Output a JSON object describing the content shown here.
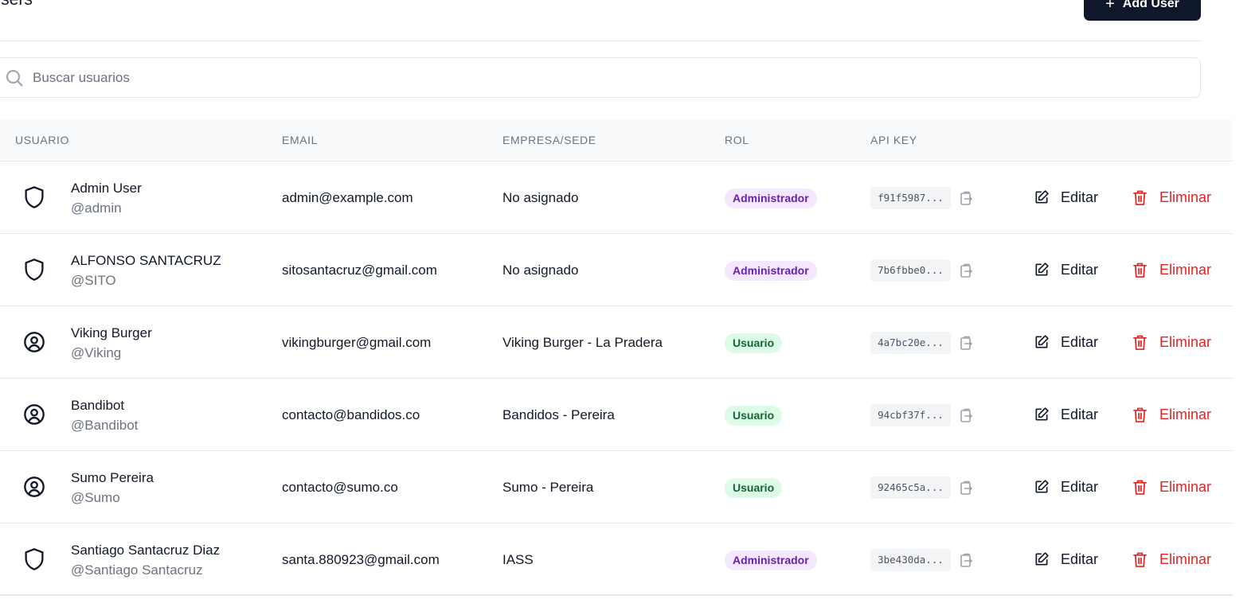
{
  "header": {
    "title": "Users",
    "add_user_label": "Add User"
  },
  "search": {
    "placeholder": "Buscar usuarios"
  },
  "table": {
    "columns": [
      "USUARIO",
      "EMAIL",
      "EMPRESA/SEDE",
      "ROL",
      "API KEY"
    ],
    "rows": [
      {
        "name": "Admin User",
        "handle": "@admin",
        "email": "admin@example.com",
        "company": "No asignado",
        "role": "Administrador",
        "role_type": "admin",
        "icon": "shield-icon",
        "api_key": "f91f5987...",
        "edit_label": "Editar",
        "delete_label": "Eliminar"
      },
      {
        "name": "ALFONSO SANTACRUZ",
        "handle": "@SITO",
        "email": "sitosantacruz@gmail.com",
        "company": "No asignado",
        "role": "Administrador",
        "role_type": "admin",
        "icon": "shield-icon",
        "api_key": "7b6fbbe0...",
        "edit_label": "Editar",
        "delete_label": "Eliminar"
      },
      {
        "name": "Viking Burger",
        "handle": "@Viking",
        "email": "vikingburger@gmail.com",
        "company": "Viking Burger - La Pradera",
        "role": "Usuario",
        "role_type": "user",
        "icon": "user-circle-icon",
        "api_key": "4a7bc20e...",
        "edit_label": "Editar",
        "delete_label": "Eliminar"
      },
      {
        "name": "Bandibot",
        "handle": "@Bandibot",
        "email": "contacto@bandidos.co",
        "company": "Bandidos - Pereira",
        "role": "Usuario",
        "role_type": "user",
        "icon": "user-circle-icon",
        "api_key": "94cbf37f...",
        "edit_label": "Editar",
        "delete_label": "Eliminar"
      },
      {
        "name": "Sumo Pereira",
        "handle": "@Sumo",
        "email": "contacto@sumo.co",
        "company": "Sumo - Pereira",
        "role": "Usuario",
        "role_type": "user",
        "icon": "user-circle-icon",
        "api_key": "92465c5a...",
        "edit_label": "Editar",
        "delete_label": "Eliminar"
      },
      {
        "name": "Santiago Santacruz Diaz",
        "handle": "@Santiago Santacruz",
        "email": "santa.880923@gmail.com",
        "company": "IASS",
        "role": "Administrador",
        "role_type": "admin",
        "icon": "shield-icon",
        "api_key": "3be430da...",
        "edit_label": "Editar",
        "delete_label": "Eliminar"
      }
    ]
  },
  "colors": {
    "primary_button": "#0f172a",
    "danger": "#dc2626",
    "admin_badge_bg": "#f3e8ff",
    "admin_badge_text": "#6b21a8",
    "user_badge_bg": "#dcfce7",
    "user_badge_text": "#166534"
  }
}
